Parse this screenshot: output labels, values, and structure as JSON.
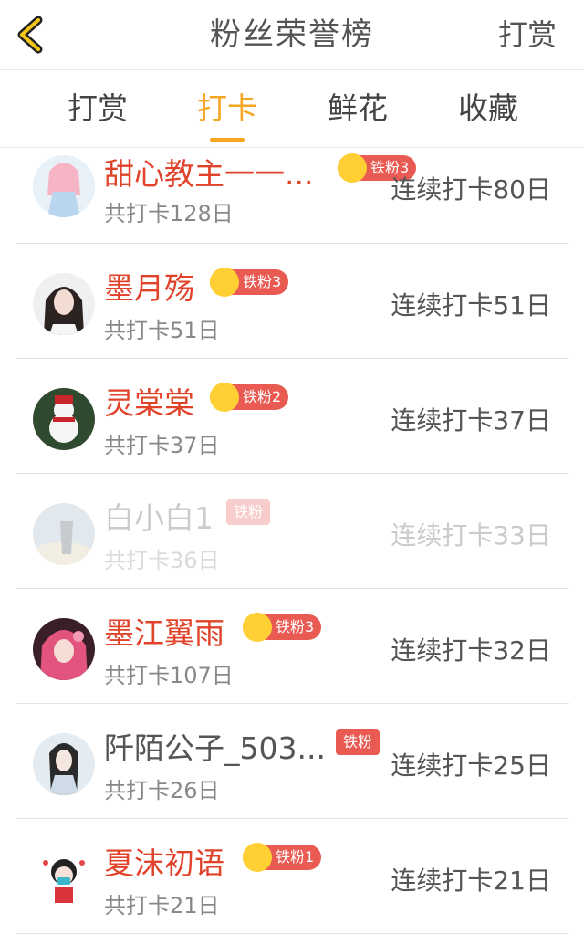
{
  "header": {
    "title": "粉丝荣誉榜",
    "right_link": "打赏"
  },
  "tabs": [
    {
      "label": "打赏",
      "active": false
    },
    {
      "label": "打卡",
      "active": true
    },
    {
      "label": "鲜花",
      "active": false
    },
    {
      "label": "收藏",
      "active": false
    }
  ],
  "colors": {
    "accent": "#f5a623",
    "name_red": "#e0432a",
    "badge_red": "#e85a52"
  },
  "rows": [
    {
      "name": "甜心教主一一...",
      "badge": "铁粉3",
      "total": "共打卡128日",
      "streak": "连续打卡80日"
    },
    {
      "name": "墨月殇",
      "badge": "铁粉3",
      "total": "共打卡51日",
      "streak": "连续打卡51日"
    },
    {
      "name": "灵棠棠",
      "badge": "铁粉2",
      "total": "共打卡37日",
      "streak": "连续打卡37日"
    },
    {
      "name": "白小白1",
      "badge": "铁粉",
      "total": "共打卡36日",
      "streak": "连续打卡33日"
    },
    {
      "name": "墨江翼雨",
      "badge": "铁粉3",
      "total": "共打卡107日",
      "streak": "连续打卡32日"
    },
    {
      "name": "阡陌公子_503...",
      "badge": "铁粉",
      "total": "共打卡26日",
      "streak": "连续打卡25日"
    },
    {
      "name": "夏沫初语",
      "badge": "铁粉1",
      "total": "共打卡21日",
      "streak": "连续打卡21日"
    }
  ]
}
